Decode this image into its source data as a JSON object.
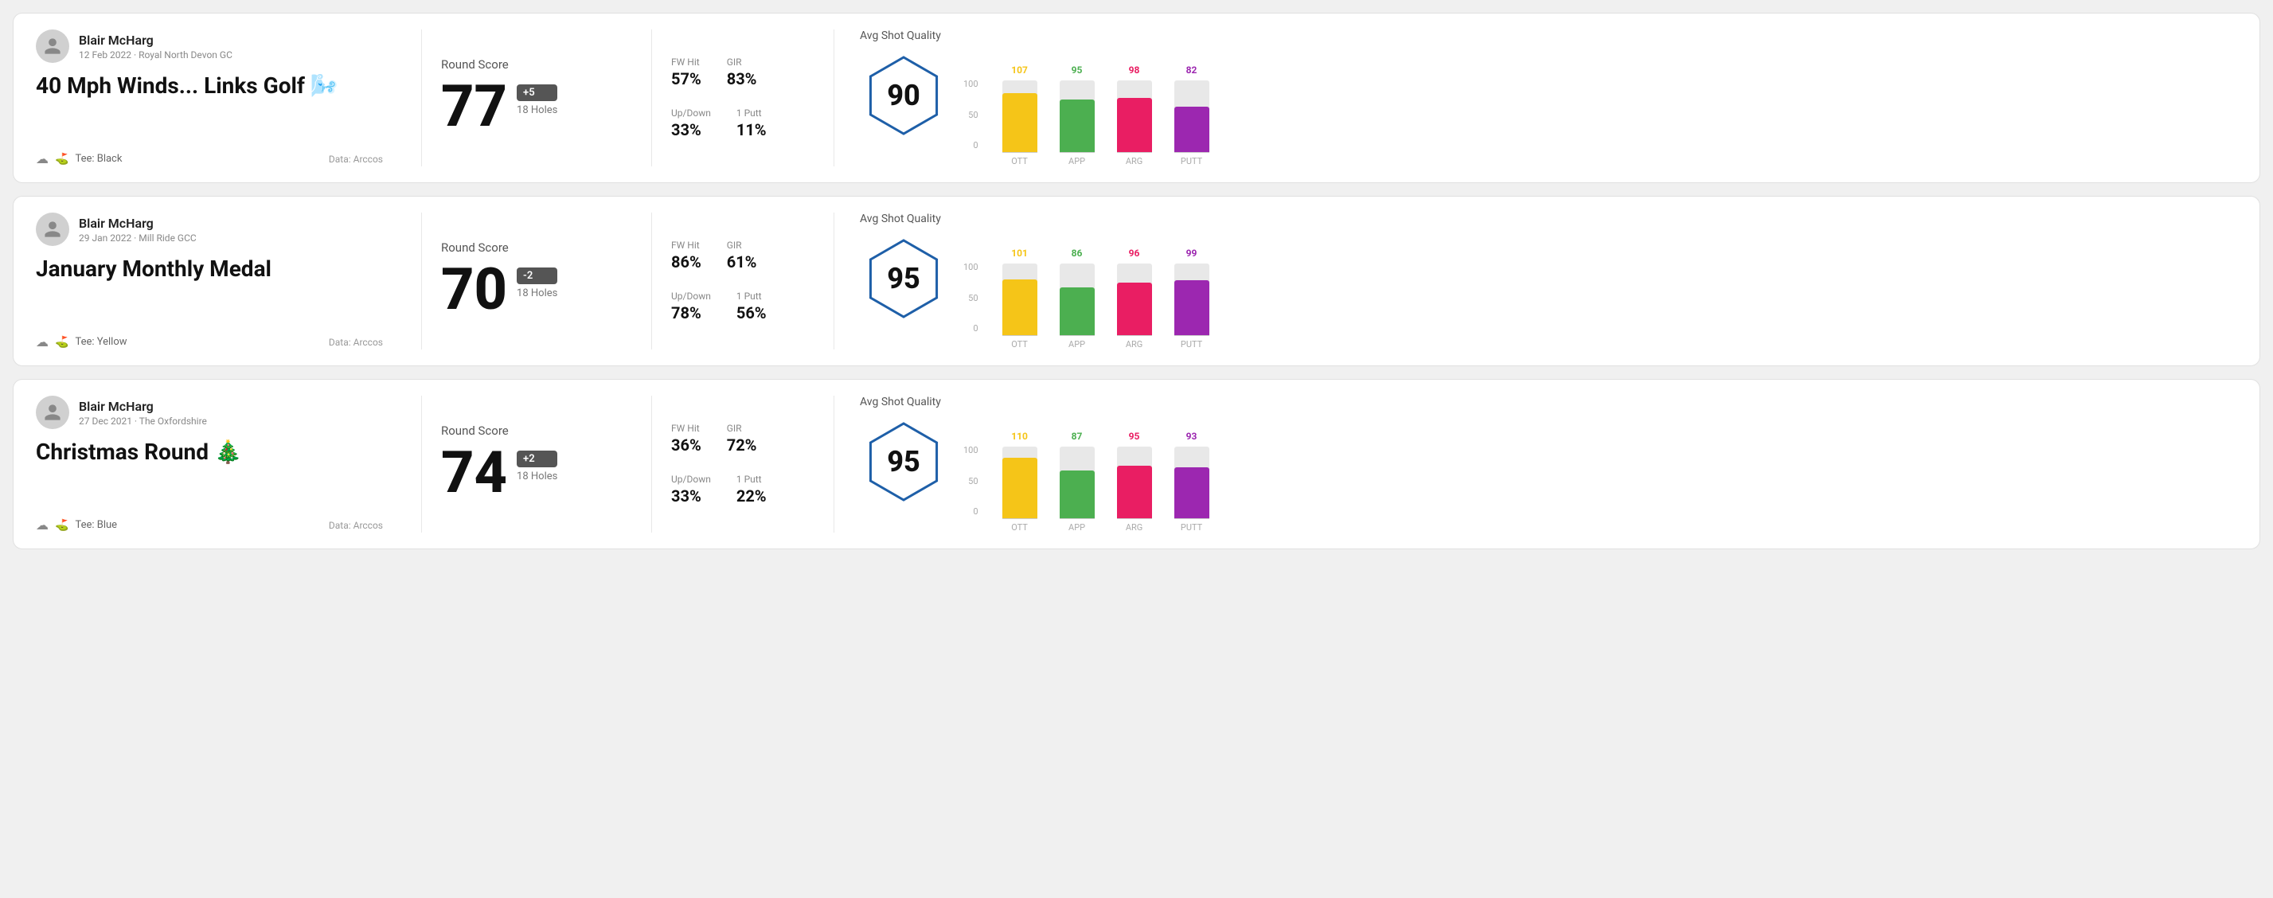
{
  "rounds": [
    {
      "id": "round-1",
      "user": {
        "name": "Blair McHarg",
        "date": "12 Feb 2022 · Royal North Devon GC"
      },
      "title": "40 Mph Winds... Links Golf",
      "title_emoji": "🌬️",
      "tee": "Black",
      "data_source": "Data: Arccos",
      "score": {
        "label": "Round Score",
        "value": "77",
        "badge": "+5",
        "holes": "18 Holes"
      },
      "stats": {
        "fw_hit_label": "FW Hit",
        "fw_hit_value": "57%",
        "gir_label": "GIR",
        "gir_value": "83%",
        "updown_label": "Up/Down",
        "updown_value": "33%",
        "oneputt_label": "1 Putt",
        "oneputt_value": "11%"
      },
      "quality": {
        "label": "Avg Shot Quality",
        "score": "90"
      },
      "bars": [
        {
          "label": "OTT",
          "value": 107,
          "max": 130,
          "color": "#f5c518"
        },
        {
          "label": "APP",
          "value": 95,
          "max": 130,
          "color": "#4caf50"
        },
        {
          "label": "ARG",
          "value": 98,
          "max": 130,
          "color": "#e91e63"
        },
        {
          "label": "PUTT",
          "value": 82,
          "max": 130,
          "color": "#9c27b0"
        }
      ]
    },
    {
      "id": "round-2",
      "user": {
        "name": "Blair McHarg",
        "date": "29 Jan 2022 · Mill Ride GCC"
      },
      "title": "January Monthly Medal",
      "title_emoji": "",
      "tee": "Yellow",
      "data_source": "Data: Arccos",
      "score": {
        "label": "Round Score",
        "value": "70",
        "badge": "-2",
        "holes": "18 Holes"
      },
      "stats": {
        "fw_hit_label": "FW Hit",
        "fw_hit_value": "86%",
        "gir_label": "GIR",
        "gir_value": "61%",
        "updown_label": "Up/Down",
        "updown_value": "78%",
        "oneputt_label": "1 Putt",
        "oneputt_value": "56%"
      },
      "quality": {
        "label": "Avg Shot Quality",
        "score": "95"
      },
      "bars": [
        {
          "label": "OTT",
          "value": 101,
          "max": 130,
          "color": "#f5c518"
        },
        {
          "label": "APP",
          "value": 86,
          "max": 130,
          "color": "#4caf50"
        },
        {
          "label": "ARG",
          "value": 96,
          "max": 130,
          "color": "#e91e63"
        },
        {
          "label": "PUTT",
          "value": 99,
          "max": 130,
          "color": "#9c27b0"
        }
      ]
    },
    {
      "id": "round-3",
      "user": {
        "name": "Blair McHarg",
        "date": "27 Dec 2021 · The Oxfordshire"
      },
      "title": "Christmas Round",
      "title_emoji": "🎄",
      "tee": "Blue",
      "data_source": "Data: Arccos",
      "score": {
        "label": "Round Score",
        "value": "74",
        "badge": "+2",
        "holes": "18 Holes"
      },
      "stats": {
        "fw_hit_label": "FW Hit",
        "fw_hit_value": "36%",
        "gir_label": "GIR",
        "gir_value": "72%",
        "updown_label": "Up/Down",
        "updown_value": "33%",
        "oneputt_label": "1 Putt",
        "oneputt_value": "22%"
      },
      "quality": {
        "label": "Avg Shot Quality",
        "score": "95"
      },
      "bars": [
        {
          "label": "OTT",
          "value": 110,
          "max": 130,
          "color": "#f5c518"
        },
        {
          "label": "APP",
          "value": 87,
          "max": 130,
          "color": "#4caf50"
        },
        {
          "label": "ARG",
          "value": 95,
          "max": 130,
          "color": "#e91e63"
        },
        {
          "label": "PUTT",
          "value": 93,
          "max": 130,
          "color": "#9c27b0"
        }
      ]
    }
  ],
  "chart": {
    "y_labels": [
      "100",
      "50",
      "0"
    ]
  }
}
